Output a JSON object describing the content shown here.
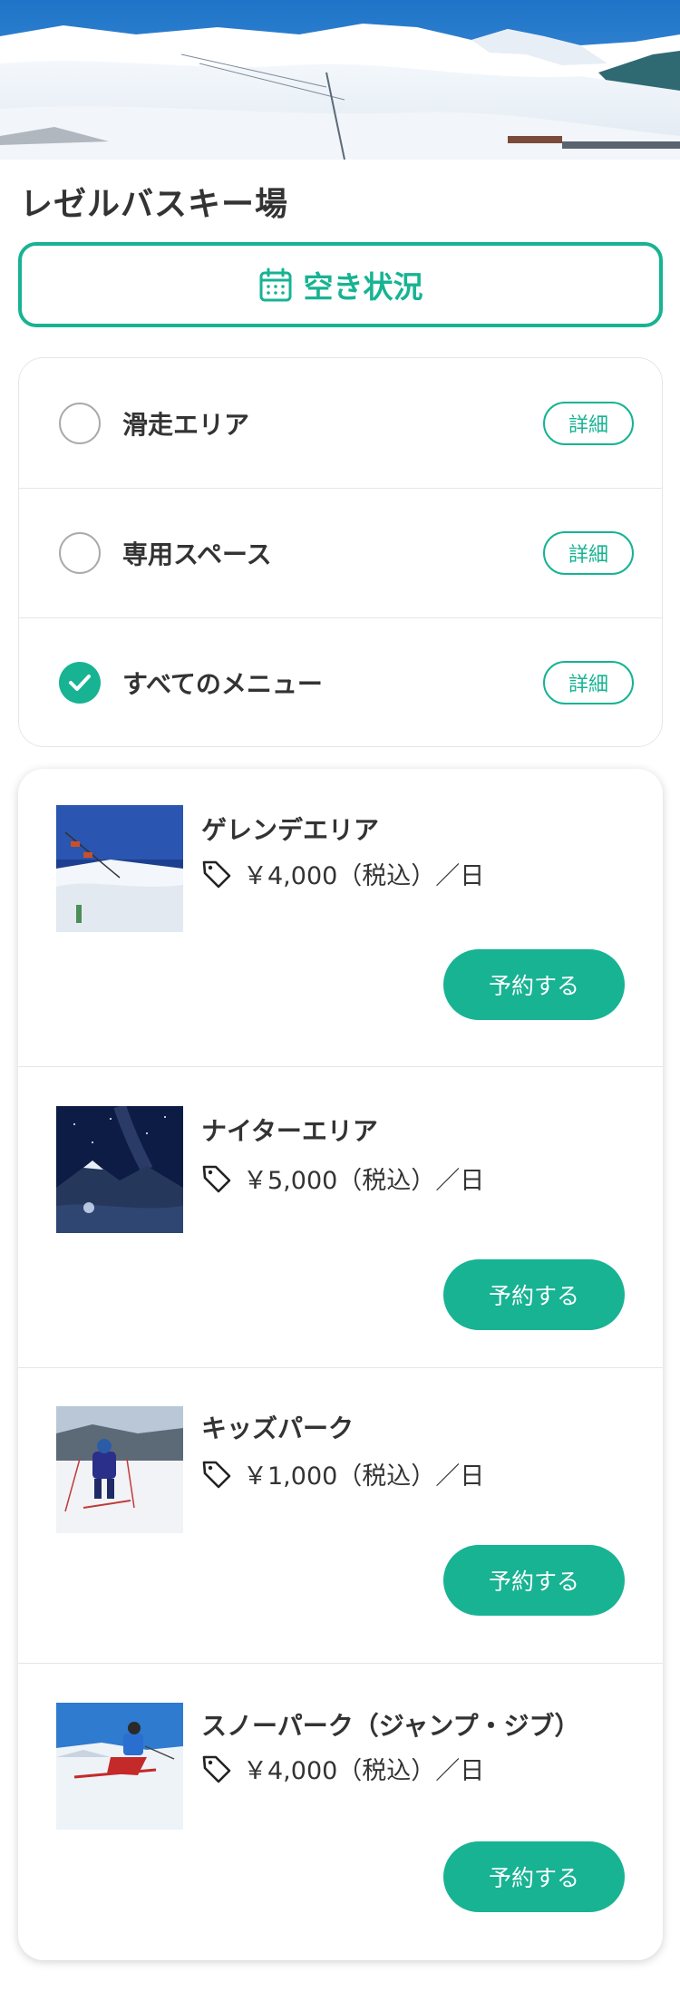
{
  "page": {
    "title": "レゼルバスキー場"
  },
  "availability": {
    "label": "空き状況",
    "icon": "calendar-icon"
  },
  "filters": [
    {
      "label": "滑走エリア",
      "checked": false,
      "detail_label": "詳細"
    },
    {
      "label": "専用スペース",
      "checked": false,
      "detail_label": "詳細"
    },
    {
      "label": "すべてのメニュー",
      "checked": true,
      "detail_label": "詳細"
    }
  ],
  "menu_items": [
    {
      "name": "ゲレンデエリア",
      "price": "￥4,000（税込）／日",
      "button": "予約する",
      "icon": "price-tag-icon"
    },
    {
      "name": "ナイターエリア",
      "price": "￥5,000（税込）／日",
      "button": "予約する",
      "icon": "price-tag-icon"
    },
    {
      "name": "キッズパーク",
      "price": "￥1,000（税込）／日",
      "button": "予約する",
      "icon": "price-tag-icon"
    },
    {
      "name": "スノーパーク（ジャンプ・ジブ）",
      "price": "￥4,000（税込）／日",
      "button": "予約する",
      "icon": "price-tag-icon"
    }
  ],
  "colors": {
    "accent": "#17b393",
    "text": "#333333",
    "border": "#e6e6e6"
  }
}
